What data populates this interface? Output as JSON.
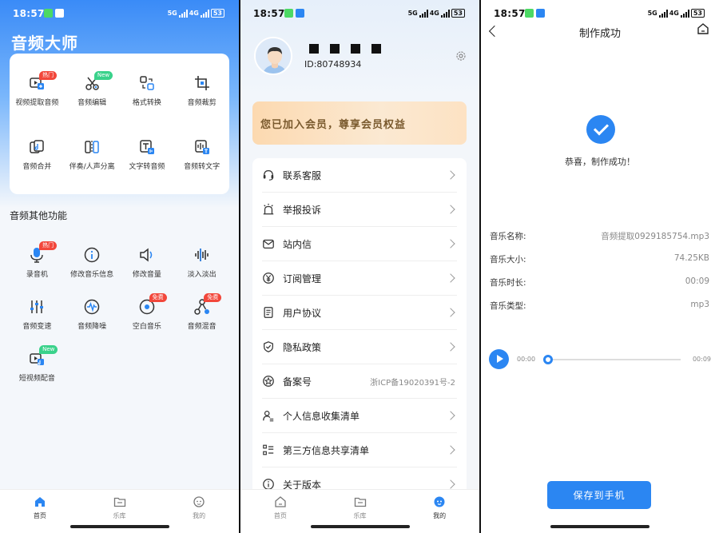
{
  "status": {
    "time": "18:57",
    "network": "5G",
    "network2": "4G",
    "battery": "53"
  },
  "colors": {
    "accent": "#2b86f2",
    "hot": "#f2473b",
    "new": "#3ad28b"
  },
  "home": {
    "title": "音频大师",
    "tools": [
      {
        "label": "视频提取音频",
        "icon": "video-extract-icon",
        "badge": "热门",
        "badge_type": "hot"
      },
      {
        "label": "音频编辑",
        "icon": "scissors-icon",
        "badge": "New",
        "badge_type": "new"
      },
      {
        "label": "格式转换",
        "icon": "format-convert-icon",
        "badge": "",
        "badge_type": ""
      },
      {
        "label": "音频裁剪",
        "icon": "crop-icon",
        "badge": "",
        "badge_type": ""
      },
      {
        "label": "音频合并",
        "icon": "merge-icon",
        "badge": "",
        "badge_type": ""
      },
      {
        "label": "伴奏/人声分离",
        "icon": "split-icon",
        "badge": "",
        "badge_type": ""
      },
      {
        "label": "文字转音频",
        "icon": "text-to-audio-icon",
        "badge": "",
        "badge_type": ""
      },
      {
        "label": "音频转文字",
        "icon": "audio-to-text-icon",
        "badge": "",
        "badge_type": ""
      }
    ],
    "other_title": "音频其他功能",
    "other_tools": [
      {
        "label": "录音机",
        "icon": "microphone-icon",
        "badge": "热门",
        "badge_type": "hot"
      },
      {
        "label": "修改音乐信息",
        "icon": "info-icon",
        "badge": "",
        "badge_type": ""
      },
      {
        "label": "修改音量",
        "icon": "volume-icon",
        "badge": "",
        "badge_type": ""
      },
      {
        "label": "淡入淡出",
        "icon": "waveform-icon",
        "badge": "",
        "badge_type": ""
      },
      {
        "label": "音频变速",
        "icon": "equalizer-icon",
        "badge": "",
        "badge_type": ""
      },
      {
        "label": "音频降噪",
        "icon": "denoise-icon",
        "badge": "",
        "badge_type": ""
      },
      {
        "label": "空白音乐",
        "icon": "disc-icon",
        "badge": "免费",
        "badge_type": "hot"
      },
      {
        "label": "音频混音",
        "icon": "mix-icon",
        "badge": "免费",
        "badge_type": "hot"
      },
      {
        "label": "短视频配音",
        "icon": "short-video-dub-icon",
        "badge": "New",
        "badge_type": "new"
      }
    ]
  },
  "tabs": {
    "home": "首页",
    "library": "乐库",
    "mine": "我的"
  },
  "profile": {
    "user_id": "ID:80748934",
    "vip_text": "您已加入会员，尊享会员权益",
    "menu": [
      {
        "label": "联系客服",
        "icon": "headset-icon",
        "value": ""
      },
      {
        "label": "举报投诉",
        "icon": "alarm-icon",
        "value": ""
      },
      {
        "label": "站内信",
        "icon": "mail-icon",
        "value": ""
      },
      {
        "label": "订阅管理",
        "icon": "yen-icon",
        "value": ""
      },
      {
        "label": "用户协议",
        "icon": "document-icon",
        "value": ""
      },
      {
        "label": "隐私政策",
        "icon": "shield-icon",
        "value": ""
      },
      {
        "label": "备案号",
        "icon": "star-badge-icon",
        "value": "浙ICP备19020391号-2"
      },
      {
        "label": "个人信息收集清单",
        "icon": "person-list-icon",
        "value": ""
      },
      {
        "label": "第三方信息共享清单",
        "icon": "list-icon",
        "value": ""
      },
      {
        "label": "关于版本",
        "icon": "info-circle-icon",
        "value": ""
      }
    ]
  },
  "result": {
    "title": "制作成功",
    "success_text": "恭喜，制作成功！",
    "fields": [
      {
        "label": "音乐名称:",
        "value": "音频提取0929185754.mp3"
      },
      {
        "label": "音乐大小:",
        "value": "74.25KB"
      },
      {
        "label": "音乐时长:",
        "value": "00:09"
      },
      {
        "label": "音乐类型:",
        "value": "mp3"
      }
    ],
    "player": {
      "current": "00:00",
      "total": "00:09",
      "progress": 0
    },
    "save_label": "保存到手机"
  }
}
